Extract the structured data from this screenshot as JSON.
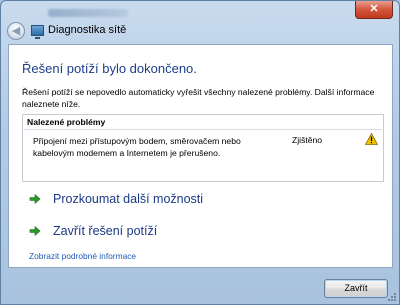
{
  "window": {
    "title": "Diagnostika sítě",
    "close_glyph": "✕",
    "back_glyph": "◀"
  },
  "content": {
    "heading": "Řešení potíží bylo dokončeno.",
    "description": "Řešení potíží se nepovedlo automaticky vyřešit všechny nalezené problémy. Další informace naleznete níže.",
    "problems": {
      "header": "Nalezené problémy",
      "items": [
        {
          "text": "Připojení mezi přístupovým bodem, směrovačem nebo kabelovým modemem a Internetem je přerušeno.",
          "status": "Zjištěno",
          "icon": "warning-icon"
        }
      ]
    },
    "actions": [
      {
        "label": "Prozkoumat další možnosti",
        "icon": "green-arrow-icon"
      },
      {
        "label": "Zavřít řešení potíží",
        "icon": "green-arrow-icon"
      }
    ],
    "details_link": "Zobrazit podrobné informace"
  },
  "footer": {
    "close_label": "Zavřít"
  },
  "colors": {
    "heading": "#1e3f8c",
    "link": "#1e5bb8",
    "arrow": "#2a9a2a",
    "warning": "#f2c200"
  }
}
